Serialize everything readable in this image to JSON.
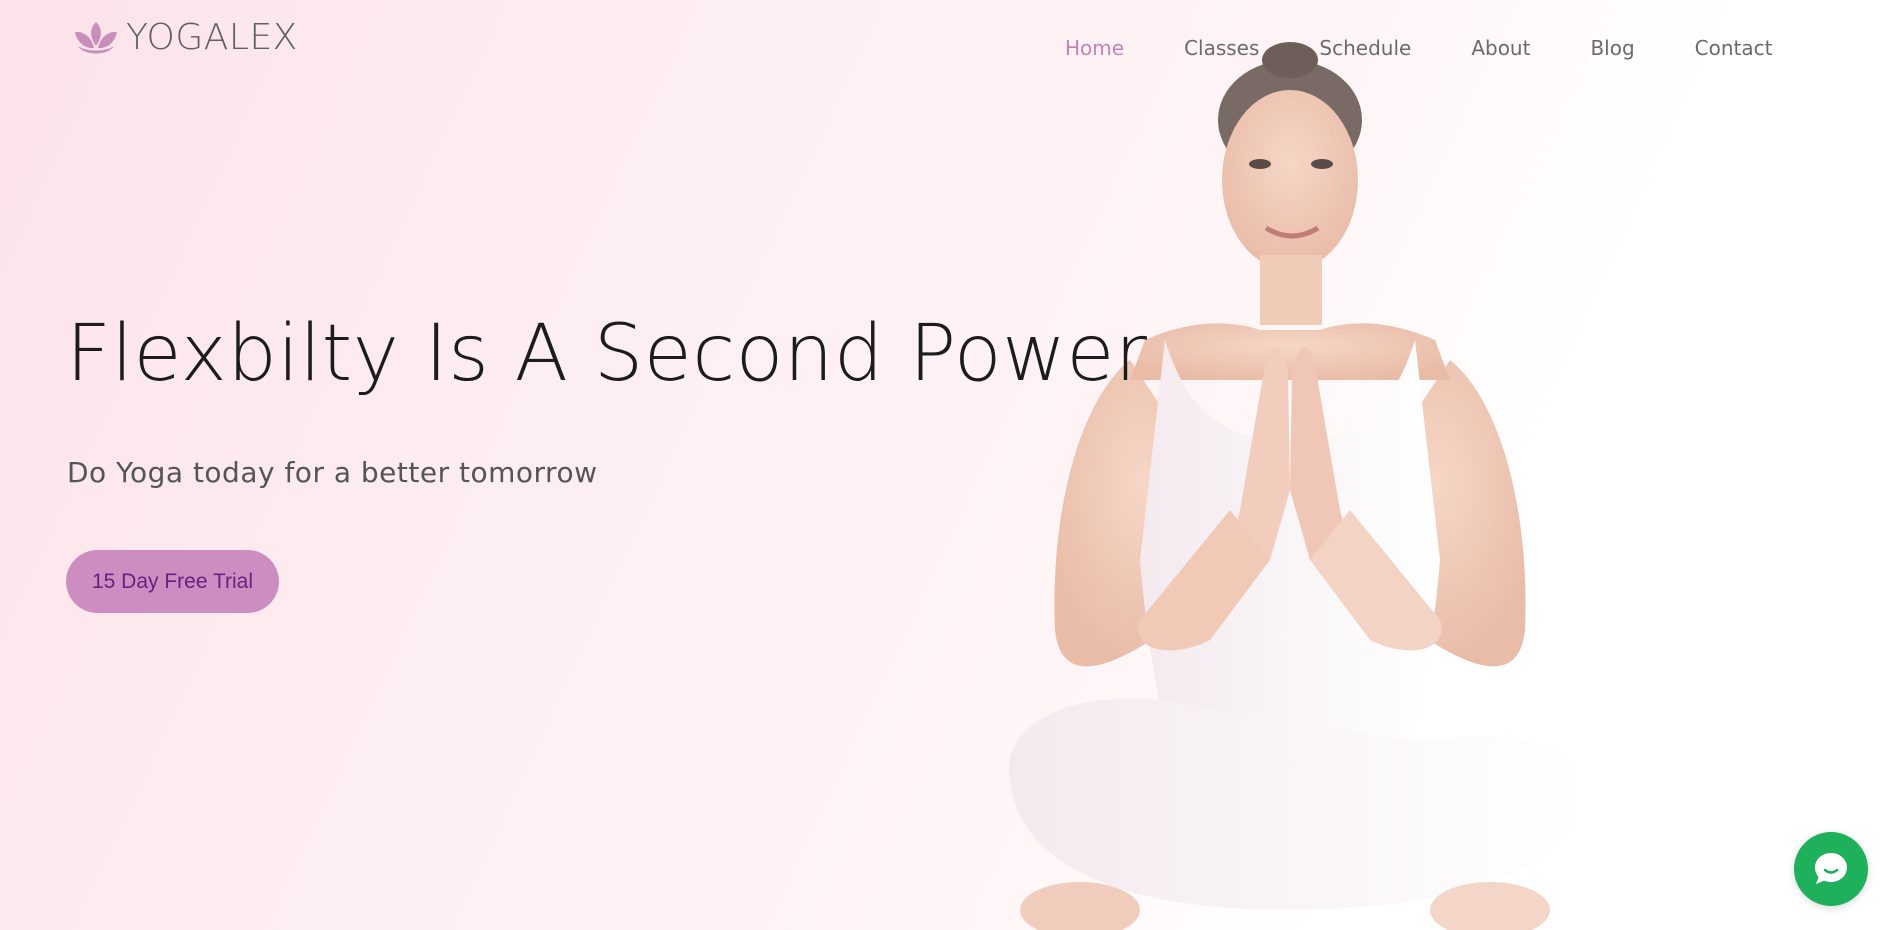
{
  "brand": {
    "name": "YOGALEX",
    "logo_icon": "lotus-icon",
    "accent_color": "#c882b6"
  },
  "nav": {
    "items": [
      {
        "label": "Home",
        "active": true
      },
      {
        "label": "Classes",
        "active": false
      },
      {
        "label": "Schedule",
        "active": false
      },
      {
        "label": "About",
        "active": false
      },
      {
        "label": "Blog",
        "active": false
      },
      {
        "label": "Contact",
        "active": false
      }
    ]
  },
  "hero": {
    "title": "Flexbilty Is A Second Power",
    "subtitle": "Do Yoga today for a better tomorrow",
    "cta_label": "15 Day Free Trial",
    "cta_color": "#cc8ec0",
    "cta_text_color": "#6a1f83",
    "image": "woman-meditating-photo"
  },
  "chat": {
    "icon": "chat-bubble-icon",
    "color": "#1eb05a"
  }
}
